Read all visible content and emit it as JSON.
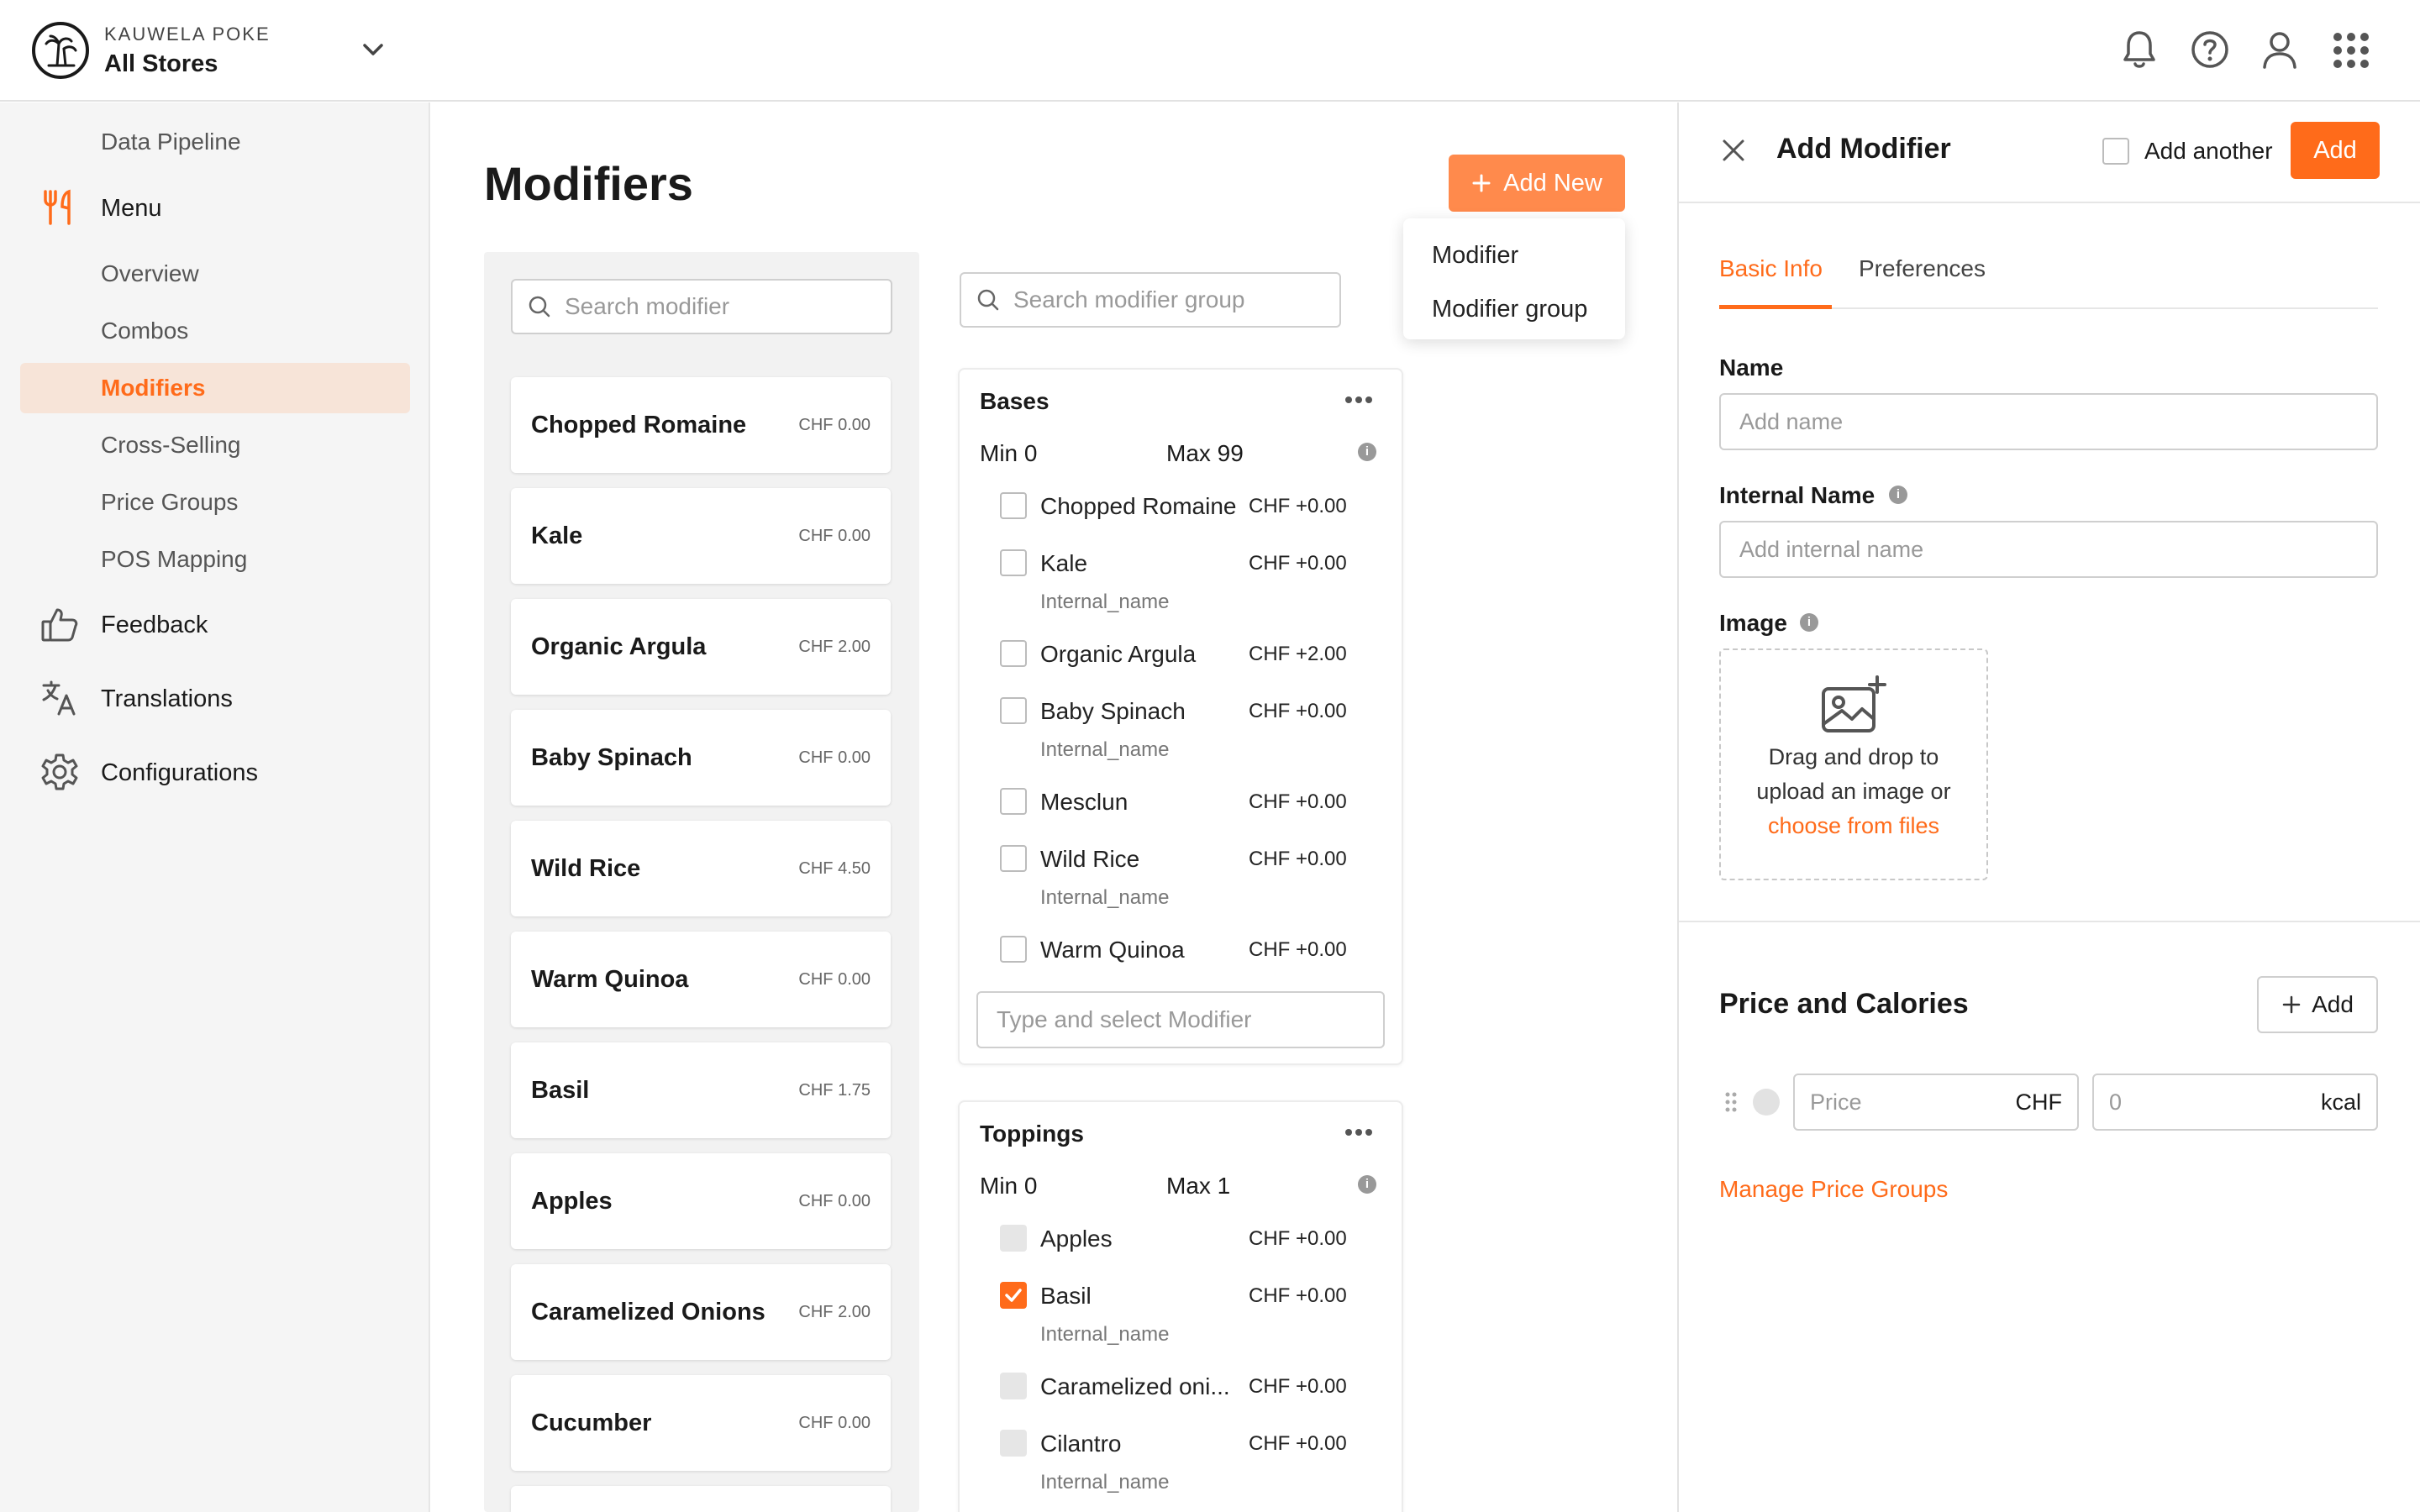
{
  "header": {
    "brand": "KAUWELA POKE",
    "store": "All Stores",
    "icons": [
      "bell-icon",
      "help-icon",
      "user-icon",
      "apps-grid-icon"
    ]
  },
  "sidebar": {
    "items": [
      {
        "label": "Data Pipeline",
        "type": "sub"
      },
      {
        "label": "Menu",
        "type": "main",
        "icon": "utensils-icon"
      },
      {
        "label": "Overview",
        "type": "sub"
      },
      {
        "label": "Combos",
        "type": "sub"
      },
      {
        "label": "Modifiers",
        "type": "sub",
        "active": true
      },
      {
        "label": "Cross-Selling",
        "type": "sub"
      },
      {
        "label": "Price Groups",
        "type": "sub"
      },
      {
        "label": "POS Mapping",
        "type": "sub"
      },
      {
        "label": "Feedback",
        "type": "main",
        "icon": "thumbs-up-icon"
      },
      {
        "label": "Translations",
        "type": "main",
        "icon": "translate-icon"
      },
      {
        "label": "Configurations",
        "type": "main",
        "icon": "gear-icon"
      }
    ]
  },
  "main": {
    "title": "Modifiers",
    "add_new_label": "Add New",
    "add_new_menu": [
      "Modifier",
      "Modifier group"
    ],
    "search_modifier_placeholder": "Search modifier",
    "search_group_placeholder": "Search modifier group",
    "modifiers": [
      {
        "name": "Chopped Romaine",
        "price": "CHF 0.00"
      },
      {
        "name": "Kale",
        "price": "CHF 0.00"
      },
      {
        "name": "Organic Argula",
        "price": "CHF 2.00"
      },
      {
        "name": "Baby Spinach",
        "price": "CHF 0.00"
      },
      {
        "name": "Wild Rice",
        "price": "CHF 4.50"
      },
      {
        "name": "Warm Quinoa",
        "price": "CHF 0.00"
      },
      {
        "name": "Basil",
        "price": "CHF 1.75"
      },
      {
        "name": "Apples",
        "price": "CHF 0.00"
      },
      {
        "name": "Caramelized Onions",
        "price": "CHF 2.00"
      },
      {
        "name": "Cucumber",
        "price": "CHF 0.00"
      }
    ],
    "groups": [
      {
        "title": "Bases",
        "min": "Min 0",
        "max": "Max 99",
        "type_select_placeholder": "Type and select Modifier",
        "items": [
          {
            "name": "Chopped Romaine",
            "price": "CHF +0.00",
            "internal": "",
            "state": "unchecked"
          },
          {
            "name": "Kale",
            "price": "CHF +0.00",
            "internal": "Internal_name",
            "state": "unchecked"
          },
          {
            "name": "Organic Argula",
            "price": "CHF +2.00",
            "internal": "",
            "state": "unchecked"
          },
          {
            "name": "Baby Spinach",
            "price": "CHF +0.00",
            "internal": "Internal_name",
            "state": "unchecked"
          },
          {
            "name": "Mesclun",
            "price": "CHF +0.00",
            "internal": "",
            "state": "unchecked"
          },
          {
            "name": "Wild Rice",
            "price": "CHF +0.00",
            "internal": "Internal_name",
            "state": "unchecked"
          },
          {
            "name": "Warm Quinoa",
            "price": "CHF +0.00",
            "internal": "",
            "state": "unchecked"
          }
        ]
      },
      {
        "title": "Toppings",
        "min": "Min 0",
        "max": "Max 1",
        "items": [
          {
            "name": "Apples",
            "price": "CHF +0.00",
            "internal": "",
            "state": "disabled"
          },
          {
            "name": "Basil",
            "price": "CHF +0.00",
            "internal": "Internal_name",
            "state": "checked"
          },
          {
            "name": "Caramelized oni...",
            "price": "CHF +0.00",
            "internal": "",
            "state": "disabled"
          },
          {
            "name": "Cilantro",
            "price": "CHF +0.00",
            "internal": "Internal_name",
            "state": "disabled"
          }
        ]
      }
    ]
  },
  "drawer": {
    "title": "Add Modifier",
    "add_another_label": "Add another",
    "add_label": "Add",
    "tabs": [
      {
        "label": "Basic Info",
        "active": true
      },
      {
        "label": "Preferences",
        "active": false
      }
    ],
    "name_label": "Name",
    "name_placeholder": "Add name",
    "internal_name_label": "Internal Name",
    "internal_name_placeholder": "Add internal name",
    "image_label": "Image",
    "image_drop_line1": "Drag and drop to",
    "image_drop_line2": "upload an image or",
    "image_drop_link": "choose from files",
    "price_section_title": "Price and Calories",
    "price_add_label": "Add",
    "price_placeholder": "Price",
    "price_unit": "CHF",
    "kcal_placeholder": "0",
    "kcal_unit": "kcal",
    "manage_link": "Manage Price Groups"
  },
  "colors": {
    "accent": "#ff6b1a",
    "accent_light": "#ff8a4c",
    "active_bg": "#f7e4d8"
  }
}
